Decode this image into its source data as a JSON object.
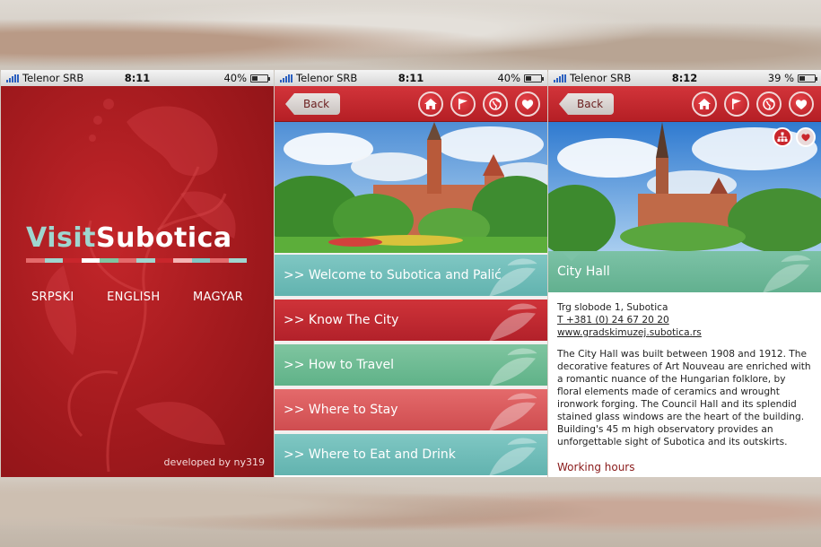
{
  "screens": [
    {
      "status": {
        "carrier": "Telenor SRB",
        "time": "8:11",
        "battery": "40%",
        "battery_level": 0.4
      },
      "logo": {
        "part1": "Visit",
        "part2": "Subotica"
      },
      "languages": [
        "SRPSKI",
        "ENGLISH",
        "MAGYAR"
      ],
      "credit": "developed by ny319"
    },
    {
      "status": {
        "carrier": "Telenor SRB",
        "time": "8:11",
        "battery": "40%",
        "battery_level": 0.4
      },
      "back_label": "Back",
      "menu": [
        ">> Welcome to Subotica and Palić",
        ">> Know The City",
        ">> How to Travel",
        ">> Where to Stay",
        ">> Where to Eat and Drink"
      ]
    },
    {
      "status": {
        "carrier": "Telenor SRB",
        "time": "8:12",
        "battery": "39 %",
        "battery_level": 0.39
      },
      "back_label": "Back",
      "title": "City Hall",
      "address": "Trg slobode 1, Subotica",
      "phone": "T +381 (0) 24 67 20 20",
      "website": "www.gradskimuzej.subotica.rs",
      "description": "The City Hall was built between 1908 and 1912. The decorative features of Art Nouveau are enriched with a romantic nuance of the Hungarian folklore, by floral elements made of ceramics and wrought ironwork forging. The Council Hall and its splendid stained glass windows are the heart of the building. Building's 45 m high observatory provides an unforgettable sight of Subotica and its outskirts.",
      "working_hours_label": "Working hours"
    }
  ],
  "colors": {
    "brand_red": "#b51f25",
    "teal": "#62b3af",
    "green": "#5fb288",
    "coral": "#cf4d50",
    "logo_teal": "#9fd6cf"
  }
}
